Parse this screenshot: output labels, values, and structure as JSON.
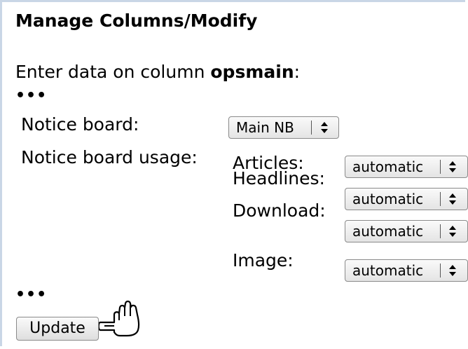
{
  "page": {
    "title": "Manage Columns/Modify",
    "intro_prefix": "Enter data on column ",
    "column_name": "opsmain",
    "intro_suffix": ":",
    "ellipsis": "•••"
  },
  "notice_board": {
    "label": "Notice board:",
    "value": "Main NB"
  },
  "usage": {
    "label": "Notice board usage:",
    "rows": [
      {
        "label": "Articles:",
        "value": "automatic"
      },
      {
        "label": "Headlines:",
        "value": "automatic"
      },
      {
        "label": "Download:",
        "value": "automatic"
      },
      {
        "label": "Image:",
        "value": "automatic"
      }
    ]
  },
  "update_button": {
    "label": "Update"
  },
  "icons": {
    "select_arrow": "up-down-arrow-icon",
    "cursor": "hand-pointer-icon"
  }
}
